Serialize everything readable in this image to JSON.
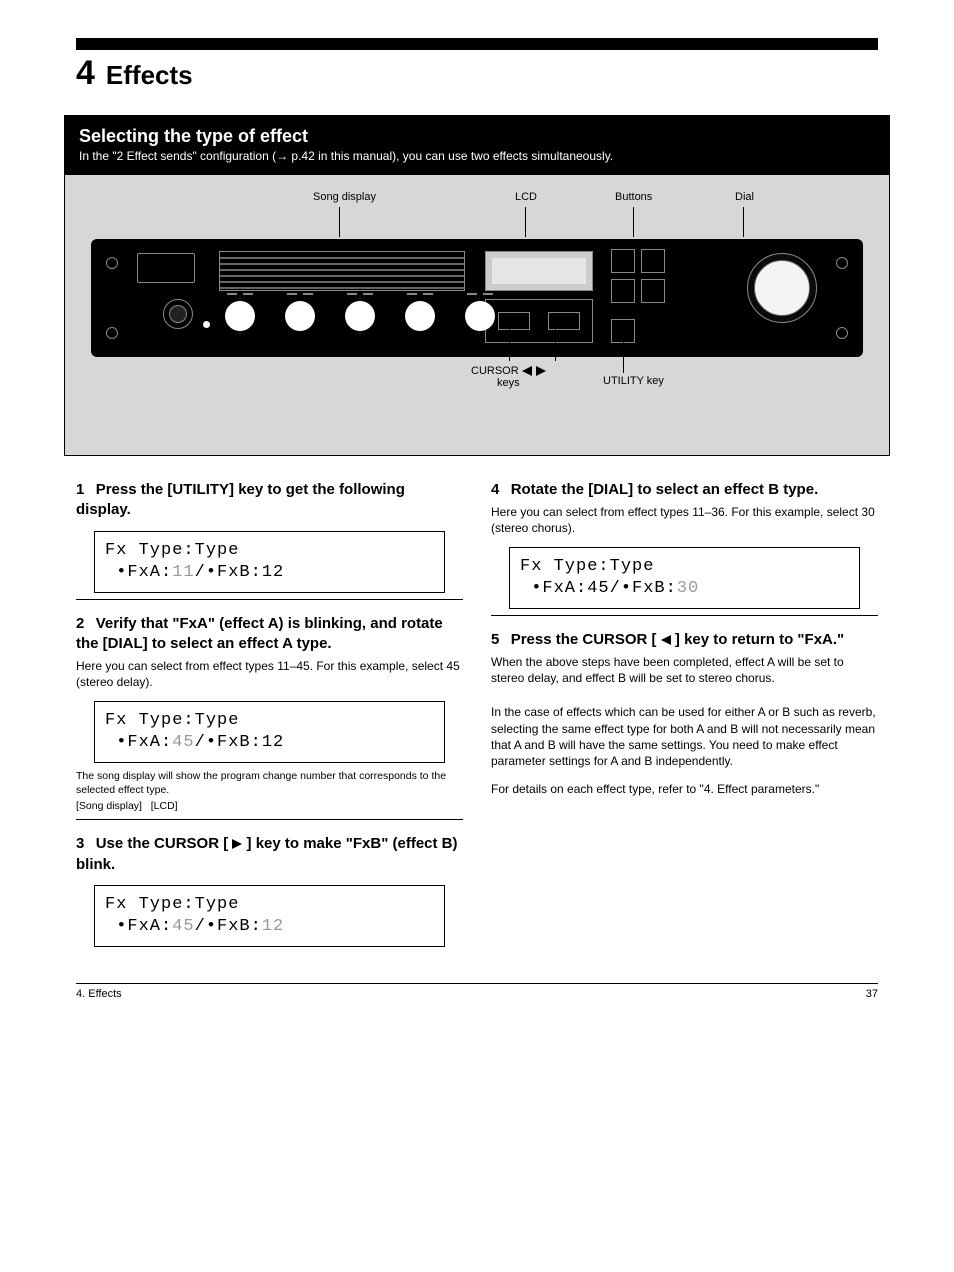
{
  "header": {
    "value": "4",
    "title": "Effects"
  },
  "section": {
    "title": "Selecting the type of effect",
    "subtitle": "In the \"2 Effect sends\" configuration (→ p.42 in this manual), you can use two effects simultaneously."
  },
  "diagram": {
    "top_labels": {
      "song": "Song display",
      "lcd": "LCD",
      "buttons": "Buttons",
      "dial": "Dial"
    },
    "bottom_labels": {
      "cursor": "CURSOR",
      "keys": "keys",
      "utility": "UTILITY key"
    }
  },
  "steps": [
    {
      "num": "1",
      "head": "Press the [UTILITY] key to get the following display.",
      "lcd_line1": "Fx Type:Type",
      "lcd_fxA_prefix": " •FxA:",
      "lcd_fxA_val": "11",
      "lcd_mid": "/•FxB:",
      "lcd_fxB_val": "12"
    },
    {
      "num": "2",
      "head": "Verify that \"FxA\" (effect A) is blinking, and rotate the [DIAL] to select an effect A type.",
      "body": "Here you can select from effect types 11–45. For this example, select 45 (stereo delay).",
      "lcd_line1": "Fx Type:Type",
      "lcd_fxA_prefix": " •FxA:",
      "lcd_fxA_val": "45",
      "lcd_mid": "/•FxB:",
      "lcd_fxB_val": "12",
      "note_head": "The song display will show the program change number that corresponds to the selected effect type.",
      "note_labels_l": "[Song display]",
      "note_labels_r": "[LCD]"
    },
    {
      "num": "3",
      "head": "Use the CURSOR [    ] key to make \"FxB\" (effect B) blink.",
      "lcd_line1": "Fx Type:Type",
      "lcd_fxA_prefix": " •FxA:",
      "lcd_fxA_val": "45",
      "lcd_mid": "/•FxB:",
      "lcd_fxB_val": "12"
    },
    {
      "num": "4",
      "head": "Rotate the [DIAL] to select an effect B type.",
      "body": "Here you can select from effect types 11–36. For this example, select 30 (stereo chorus).",
      "lcd_line1": "Fx Type:Type",
      "lcd_fxA_prefix": " •FxA:",
      "lcd_fxA_val": "45",
      "lcd_mid": "/•FxB:",
      "lcd_fxB_val": "30"
    },
    {
      "num": "5",
      "head": "Press the CURSOR [    ] key to return to \"FxA.\"",
      "body": "When the above steps have been completed, effect A will be set to stereo delay, and effect B will be set to stereo chorus."
    }
  ],
  "afterword": {
    "p1": "In the case of effects which can be used for either A or B such as reverb, selecting the same effect type for both A and B will not necessarily mean that A and B will have the same settings. You need to make effect parameter settings for A and B independently.",
    "p2": "For details on each effect type, refer to \"4. Effect parameters.\""
  },
  "footer": {
    "page": "37",
    "section": "4. Effects"
  }
}
